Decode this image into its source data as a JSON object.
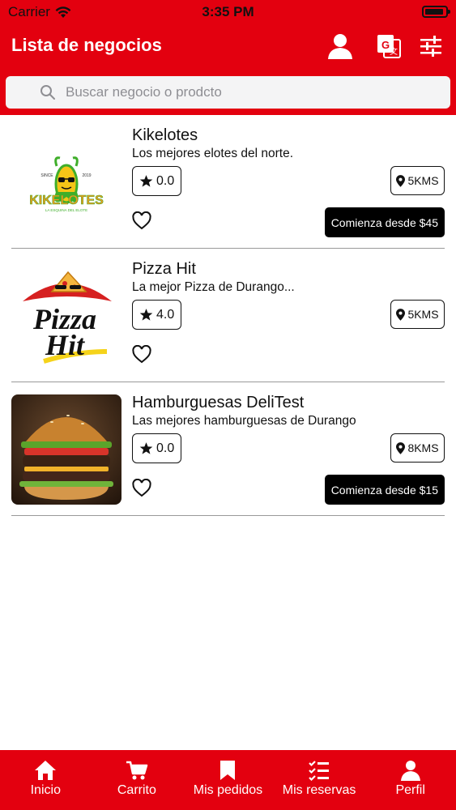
{
  "status_bar": {
    "carrier": "Carrier",
    "time": "3:35 PM"
  },
  "header": {
    "title": "Lista de negocios"
  },
  "search": {
    "placeholder": "Buscar negocio o prodcto",
    "value": ""
  },
  "businesses": [
    {
      "name": "Kikelotes",
      "description": "Los mejores elotes del norte.",
      "rating": "0.0",
      "distance": "5KMS",
      "price_label": "Comienza desde $45",
      "logo": {
        "since": "SINCE",
        "year": "2019",
        "brand": "KIKELOTES",
        "tagline": "LA ESQUINA DEL ELOTE"
      }
    },
    {
      "name": "Pizza Hit",
      "description": "La mejor Pizza de Durango...",
      "rating": "4.0",
      "distance": "5KMS",
      "price_label": "",
      "logo": {
        "line1": "Pizza",
        "line2": "Hit"
      }
    },
    {
      "name": "Hamburguesas DeliTest",
      "description": "Las mejores hamburguesas de Durango",
      "rating": "0.0",
      "distance": "8KMS",
      "price_label": "Comienza desde $15"
    }
  ],
  "tabs": [
    {
      "label": "Inicio",
      "icon": "home-icon"
    },
    {
      "label": "Carrito",
      "icon": "cart-icon"
    },
    {
      "label": "Mis pedidos",
      "icon": "bookmark-icon"
    },
    {
      "label": "Mis reservas",
      "icon": "checklist-icon"
    },
    {
      "label": "Perfil",
      "icon": "person-icon"
    }
  ],
  "colors": {
    "brand_red": "#e3000f",
    "button_black": "#000000",
    "text": "#111111"
  }
}
